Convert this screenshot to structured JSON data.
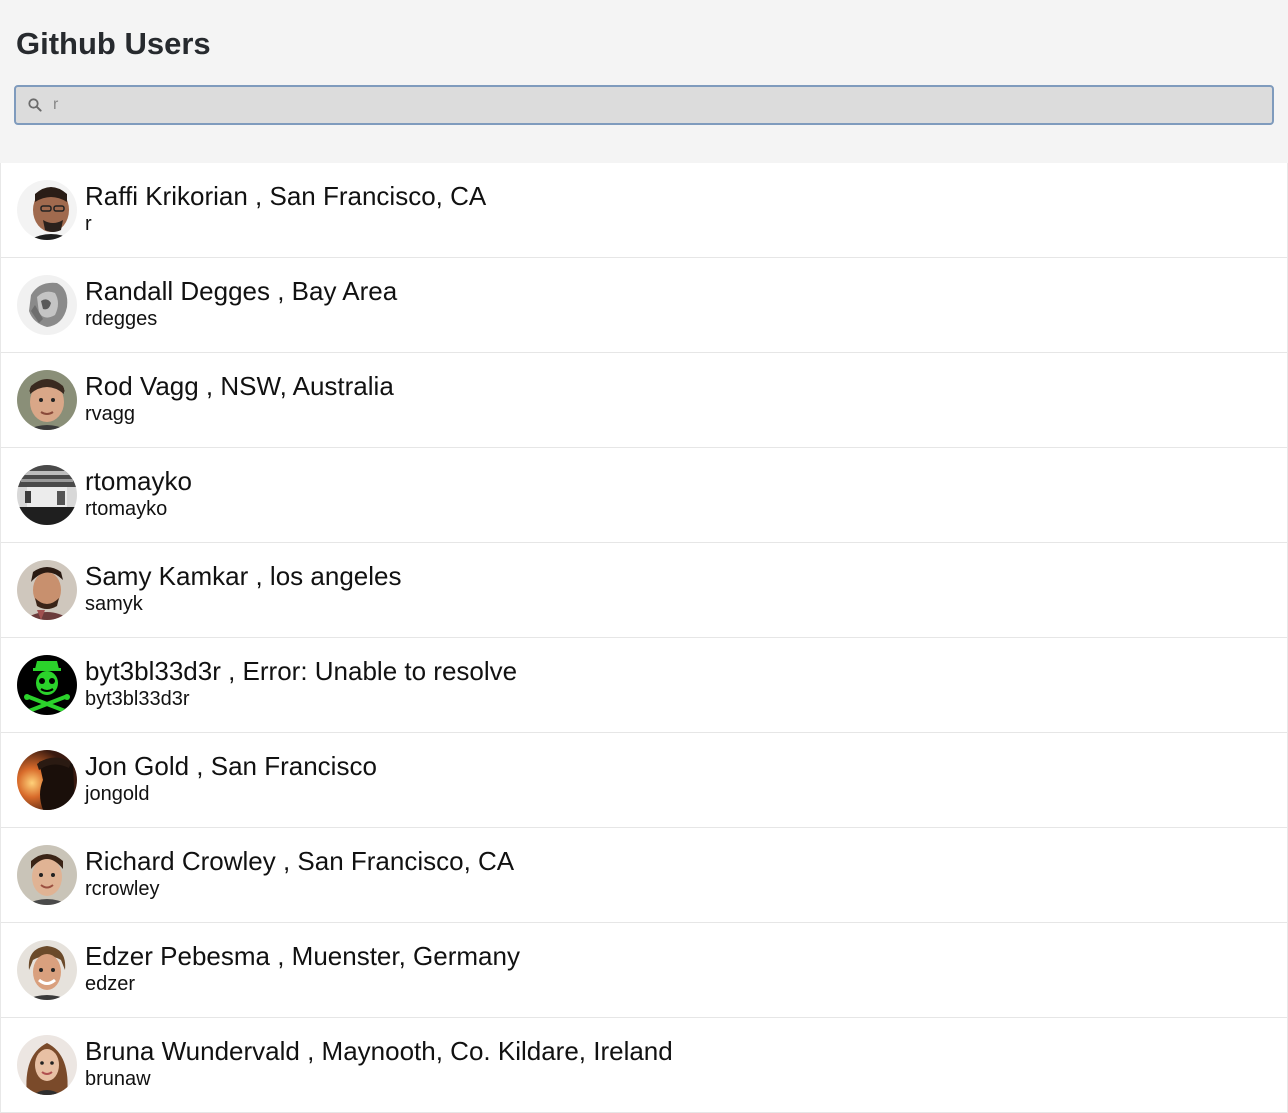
{
  "header": {
    "title": "Github Users"
  },
  "search": {
    "value": "r",
    "icon": "search-icon"
  },
  "users": [
    {
      "name": "Raffi Krikorian",
      "location": "San Francisco, CA",
      "login": "r",
      "display": "Raffi Krikorian , San Francisco, CA"
    },
    {
      "name": "Randall Degges",
      "location": "Bay Area",
      "login": "rdegges",
      "display": "Randall Degges , Bay Area"
    },
    {
      "name": "Rod Vagg",
      "location": "NSW, Australia",
      "login": "rvagg",
      "display": "Rod Vagg , NSW, Australia"
    },
    {
      "name": "rtomayko",
      "location": "",
      "login": "rtomayko",
      "display": "rtomayko"
    },
    {
      "name": "Samy Kamkar",
      "location": "los angeles",
      "login": "samyk",
      "display": "Samy Kamkar , los angeles"
    },
    {
      "name": "byt3bl33d3r",
      "location": "Error: Unable to resolve",
      "login": "byt3bl33d3r",
      "display": "byt3bl33d3r , Error: Unable to resolve"
    },
    {
      "name": "Jon Gold",
      "location": "San Francisco",
      "login": "jongold",
      "display": "Jon Gold , San Francisco"
    },
    {
      "name": "Richard Crowley",
      "location": "San Francisco, CA",
      "login": "rcrowley",
      "display": "Richard Crowley , San Francisco, CA"
    },
    {
      "name": "Edzer Pebesma",
      "location": "Muenster, Germany",
      "login": "edzer",
      "display": "Edzer Pebesma , Muenster, Germany"
    },
    {
      "name": "Bruna Wundervald",
      "location": "Maynooth, Co. Kildare, Ireland",
      "login": "brunaw",
      "display": "Bruna Wundervald , Maynooth, Co. Kildare, Ireland"
    }
  ]
}
